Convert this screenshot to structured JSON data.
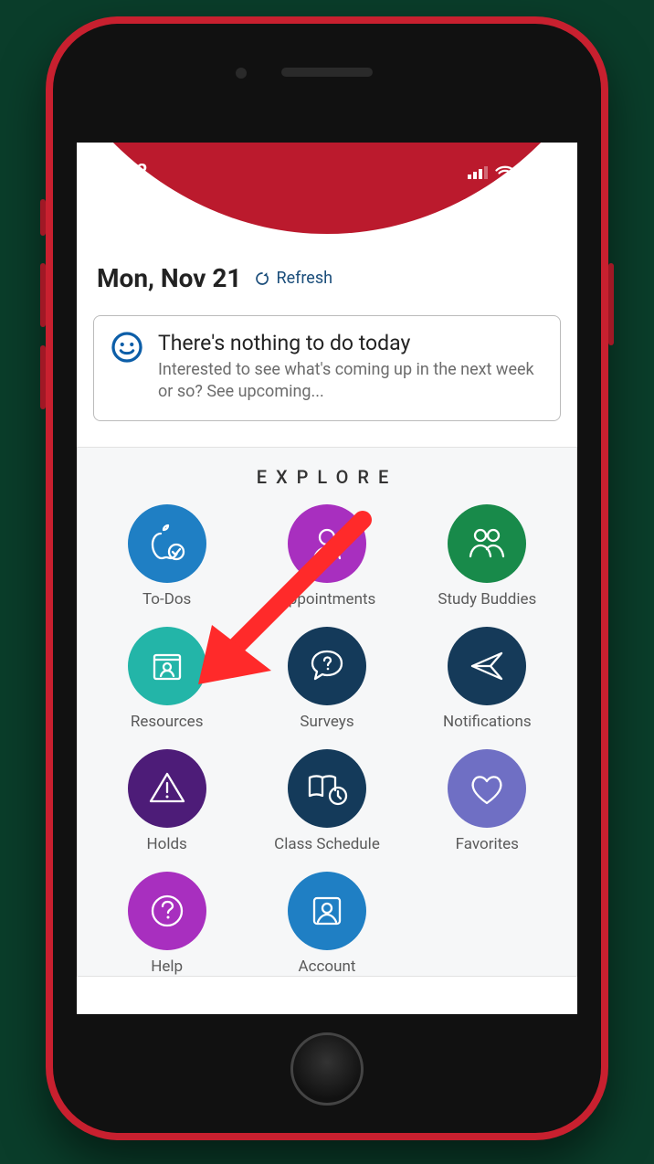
{
  "status": {
    "time": "1:02"
  },
  "header": {
    "date": "Mon, Nov 21",
    "refresh_label": "Refresh"
  },
  "today_card": {
    "title": "There's nothing to do today",
    "subtitle": "Interested to see what's coming up in the next week or so? See upcoming..."
  },
  "explore": {
    "heading": "EXPLORE",
    "items": [
      {
        "label": "To-Dos",
        "color": "#1f7fc4",
        "icon": "apple-check-icon"
      },
      {
        "label": "Appointments",
        "color": "#a82fbf",
        "icon": "person-icon"
      },
      {
        "label": "Study Buddies",
        "color": "#188a4a",
        "icon": "two-people-icon"
      },
      {
        "label": "Resources",
        "color": "#23b5a8",
        "icon": "id-card-icon"
      },
      {
        "label": "Surveys",
        "color": "#143a5a",
        "icon": "speech-question-icon"
      },
      {
        "label": "Notifications",
        "color": "#153a59",
        "icon": "send-icon"
      },
      {
        "label": "Holds",
        "color": "#4d1c78",
        "icon": "warning-triangle-icon"
      },
      {
        "label": "Class Schedule",
        "color": "#143a5a",
        "icon": "book-clock-icon"
      },
      {
        "label": "Favorites",
        "color": "#6f6fc4",
        "icon": "heart-icon"
      },
      {
        "label": "Help",
        "color": "#a82fbf",
        "icon": "help-circle-icon"
      },
      {
        "label": "Account",
        "color": "#1f7fc4",
        "icon": "account-square-icon"
      }
    ]
  },
  "annotation": {
    "arrow_target": "Resources"
  }
}
